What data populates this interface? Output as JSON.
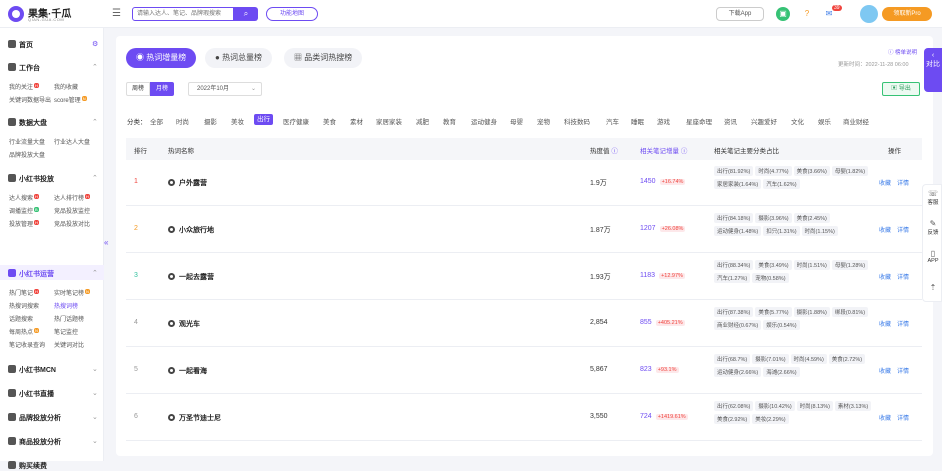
{
  "header": {
    "brand": "果集·千瓜",
    "brand_sub": "QIAN-GUA.COM",
    "search_placeholder": "请输入达人、笔记、品牌瑕搜索",
    "feature_map": "功能地图",
    "download_app": "下载App",
    "notify_count": "39",
    "vip_label": "领取新Pro",
    "help": "?"
  },
  "sidebar": {
    "sections": [
      {
        "label": "首页"
      },
      {
        "label": "工作台",
        "items": [
          "我的关注",
          "我的收藏",
          "关键词数据导出",
          "score管理"
        ]
      },
      {
        "label": "数据大盘",
        "items": [
          "行业流量大盘",
          "行业达人大盘",
          "品牌投放大盘"
        ]
      },
      {
        "label": "小红书投放",
        "items": [
          "达人搜索",
          "达人排行榜",
          "调播监控",
          "竞品投放监控",
          "投放管理",
          "竞品投放对比"
        ]
      },
      {
        "label": "小红书运营",
        "items": [
          "热门笔记",
          "实时笔记榜",
          "热搜词搜索",
          "热搜词榜",
          "话题搜索",
          "热门话题榜",
          "每周热点",
          "笔记监控",
          "笔记收录查询",
          "关键词对比"
        ]
      },
      {
        "label": "小红书MCN"
      },
      {
        "label": "小红书直播"
      },
      {
        "label": "品牌投放分析"
      },
      {
        "label": "商品投放分析"
      },
      {
        "label": "购买续费"
      }
    ]
  },
  "tabs": [
    "热词增量榜",
    "热词总量榜",
    "品类词热搜榜"
  ],
  "note_link": "榜单说明",
  "update_time": "更新时间：2022-11-28 06:00",
  "period": {
    "week": "周榜",
    "month": "月榜",
    "date": "2022年10月"
  },
  "export": "导出",
  "category_label": "分类：",
  "categories": [
    "全部",
    "时尚",
    "摄影",
    "美妆",
    "出行",
    "医疗健康",
    "美食",
    "素材",
    "家居家装",
    "减肥",
    "教育",
    "运动健身",
    "母婴",
    "宠物",
    "科技数码",
    "汽车",
    "睡眠",
    "游戏",
    "星座命理",
    "资讯",
    "兴趣爱好",
    "文化",
    "娱乐",
    "商业财经"
  ],
  "active_category": "出行",
  "table": {
    "headers": [
      "排行",
      "热词名称",
      "热度值",
      "相关笔记增量",
      "相关笔记主要分类占比",
      "操作"
    ],
    "rows": [
      {
        "rank": "1",
        "word": "户外露营",
        "heat": "1.9万",
        "inc": "1450",
        "pct": "+16.74%",
        "chips": [
          "出行(81.92%)",
          "时尚(4.77%)",
          "美食(3.66%)",
          "母婴(1.82%)",
          "家居家装(1.64%)",
          "汽车(1.62%)"
        ]
      },
      {
        "rank": "2",
        "word": "小众旅行地",
        "heat": "1.87万",
        "inc": "1207",
        "pct": "+26.08%",
        "chips": [
          "出行(84.18%)",
          "摄影(3.96%)",
          "美食(2.45%)",
          "运动健身(1.48%)",
          "扣只(1.31%)",
          "时尚(1.15%)"
        ]
      },
      {
        "rank": "3",
        "word": "一起去露营",
        "heat": "1.93万",
        "inc": "1183",
        "pct": "+12.97%",
        "chips": [
          "出行(88.34%)",
          "美食(3.49%)",
          "时尚(1.51%)",
          "母婴(1.28%)",
          "汽车(1.27%)",
          "宠物(0.58%)"
        ]
      },
      {
        "rank": "4",
        "word": "观光车",
        "heat": "2,854",
        "inc": "855",
        "pct": "+405.21%",
        "chips": [
          "出行(87.38%)",
          "美食(5.77%)",
          "摄影(1.88%)",
          "绑段(0.81%)",
          "商业财经(0.67%)",
          "娱乐(0.54%)"
        ]
      },
      {
        "rank": "5",
        "word": "一起看海",
        "heat": "5,867",
        "inc": "823",
        "pct": "+93.1%",
        "chips": [
          "出行(68.7%)",
          "摄影(7.01%)",
          "时尚(4.59%)",
          "美食(2.72%)",
          "运动健身(2.66%)",
          "海滩(2.66%)"
        ]
      },
      {
        "rank": "6",
        "word": "万圣节迪士尼",
        "heat": "3,550",
        "inc": "724",
        "pct": "+1419.61%",
        "chips": [
          "出行(62.08%)",
          "摄影(10.42%)",
          "时尚(8.13%)",
          "素材(3.13%)",
          "美食(2.92%)",
          "美妆(2.29%)"
        ]
      }
    ],
    "op_fav": "收藏",
    "op_detail": "详情"
  },
  "right": {
    "contrast": "对比",
    "service": "客服",
    "feedback": "反馈",
    "app": "APP"
  }
}
